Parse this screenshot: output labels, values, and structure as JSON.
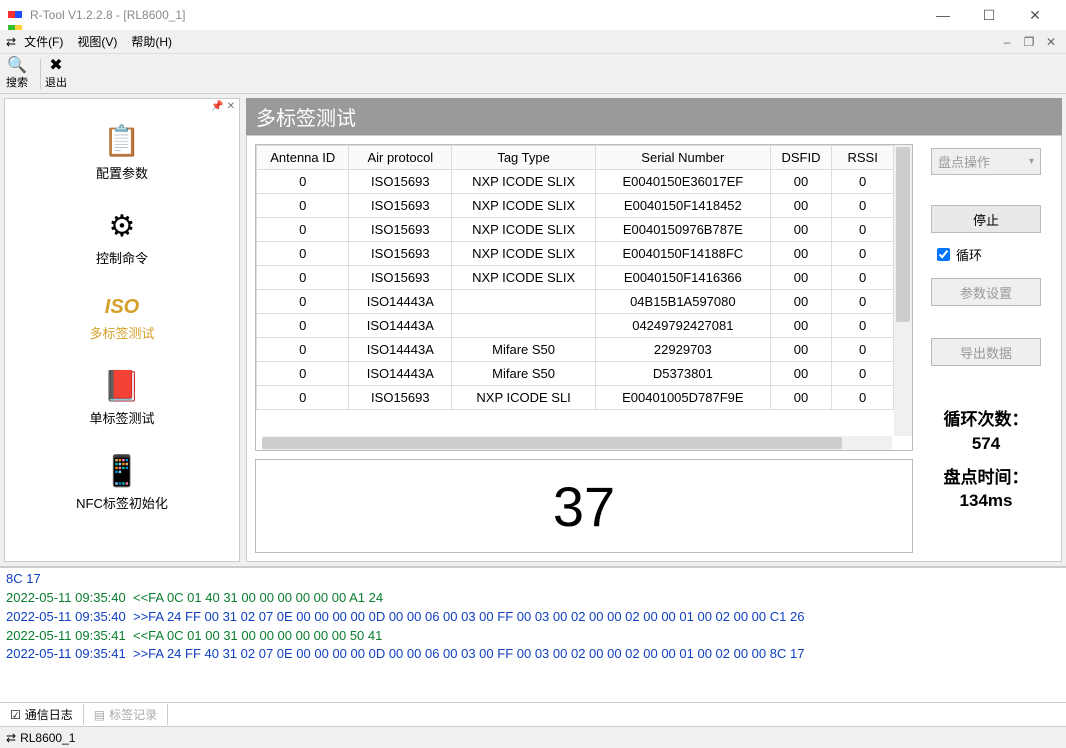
{
  "window": {
    "title": "R-Tool V1.2.2.8 - [RL8600_1]"
  },
  "menu": {
    "file": "文件(F)",
    "view": "视图(V)",
    "help": "帮助(H)"
  },
  "toolbar": {
    "search": "搜索",
    "exit": "退出"
  },
  "sidebar": {
    "items": [
      {
        "label": "配置参数"
      },
      {
        "label": "控制命令"
      },
      {
        "iso": "ISO",
        "label": "多标签测试"
      },
      {
        "label": "单标签测试"
      },
      {
        "label": "NFC标签初始化"
      }
    ]
  },
  "main": {
    "title": "多标签测试",
    "headers": [
      "Antenna ID",
      "Air protocol",
      "Tag Type",
      "Serial Number",
      "DSFID",
      "RSSI"
    ],
    "rows": [
      [
        "0",
        "ISO15693",
        "NXP ICODE SLIX",
        "E0040150E36017EF",
        "00",
        "0"
      ],
      [
        "0",
        "ISO15693",
        "NXP ICODE SLIX",
        "E0040150F1418452",
        "00",
        "0"
      ],
      [
        "0",
        "ISO15693",
        "NXP ICODE SLIX",
        "E0040150976B787E",
        "00",
        "0"
      ],
      [
        "0",
        "ISO15693",
        "NXP ICODE SLIX",
        "E0040150F14188FC",
        "00",
        "0"
      ],
      [
        "0",
        "ISO15693",
        "NXP ICODE SLIX",
        "E0040150F1416366",
        "00",
        "0"
      ],
      [
        "0",
        "ISO14443A",
        "",
        "04B15B1A597080",
        "00",
        "0"
      ],
      [
        "0",
        "ISO14443A",
        "",
        "04249792427081",
        "00",
        "0"
      ],
      [
        "0",
        "ISO14443A",
        "Mifare S50",
        "22929703",
        "00",
        "0"
      ],
      [
        "0",
        "ISO14443A",
        "Mifare S50",
        "D5373801",
        "00",
        "0"
      ],
      [
        "0",
        "ISO15693",
        "NXP ICODE SLI",
        "E00401005D787F9E",
        "00",
        "0"
      ]
    ],
    "count": "37"
  },
  "controls": {
    "mode": "盘点操作",
    "stop": "停止",
    "loop": "循环",
    "params": "参数设置",
    "export": "导出数据",
    "loop_count_label": "循环次数：",
    "loop_count": "574",
    "time_label": "盘点时间：",
    "time_value": "134ms"
  },
  "log": {
    "lines": [
      {
        "c": "b",
        "t": "8C 17"
      },
      {
        "c": "g",
        "t": "2022-05-11 09:35:40  <<FA 0C 01 40 31 00 00 00 00 00 00 A1 24"
      },
      {
        "c": "b",
        "t": "2022-05-11 09:35:40  >>FA 24 FF 00 31 02 07 0E 00 00 00 00 0D 00 00 06 00 03 00 FF 00 03 00 02 00 00 02 00 00 01 00 02 00 00 C1 26"
      },
      {
        "c": "g",
        "t": "2022-05-11 09:35:41  <<FA 0C 01 00 31 00 00 00 00 00 00 50 41"
      },
      {
        "c": "b",
        "t": "2022-05-11 09:35:41  >>FA 24 FF 40 31 02 07 0E 00 00 00 00 0D 00 00 06 00 03 00 FF 00 03 00 02 00 00 02 00 00 01 00 02 00 00 8C 17"
      }
    ],
    "tabs": {
      "comm": "通信日志",
      "tag": "标签记录"
    }
  },
  "status": {
    "doc": "RL8600_1"
  }
}
